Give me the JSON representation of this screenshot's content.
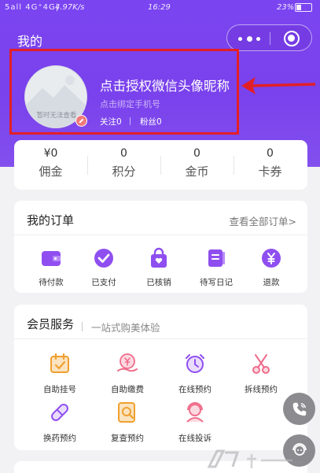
{
  "status_bar": {
    "signal": "5all 4G⁺4G|",
    "speed": "4.97K/s",
    "time": "16:29",
    "battery": "23%"
  },
  "header": {
    "title": "我的"
  },
  "profile": {
    "avatar_note": "暂时无法查看",
    "nickname": "点击授权微信头像昵称",
    "phone_prompt": "点击绑定手机号",
    "follow_label": "关注0",
    "fans_label": "粉丝0"
  },
  "stats": [
    {
      "value": "¥0",
      "label": "佣金"
    },
    {
      "value": "0",
      "label": "积分"
    },
    {
      "value": "0",
      "label": "金币"
    },
    {
      "value": "0",
      "label": "卡券"
    }
  ],
  "orders": {
    "title": "我的订单",
    "view_all": "查看全部订单>",
    "items": [
      {
        "label": "待付款",
        "icon": "wallet-icon"
      },
      {
        "label": "已支付",
        "icon": "check-circle-icon"
      },
      {
        "label": "已核销",
        "icon": "bag-icon"
      },
      {
        "label": "待写日记",
        "icon": "diary-icon"
      },
      {
        "label": "退款",
        "icon": "yen-refund-icon"
      }
    ]
  },
  "member": {
    "title": "会员服务",
    "subtitle": "一站式购美体验",
    "items": [
      {
        "label": "自助挂号",
        "icon": "calendar-check-icon"
      },
      {
        "label": "自助缴费",
        "icon": "payment-icon"
      },
      {
        "label": "在线预约",
        "icon": "alarm-clock-icon"
      },
      {
        "label": "拆线预约",
        "icon": "scissors-icon"
      },
      {
        "label": "换药预约",
        "icon": "pill-icon"
      },
      {
        "label": "复查预约",
        "icon": "search-doc-icon"
      },
      {
        "label": "在线投诉",
        "icon": "agent-icon"
      }
    ]
  },
  "colors": {
    "brand_purple": "#7a44f0",
    "highlight_red": "#e21f26",
    "icon_purple": "#8f4ff0",
    "icon_orange": "#f0a030",
    "icon_pink": "#ef6d8b"
  }
}
